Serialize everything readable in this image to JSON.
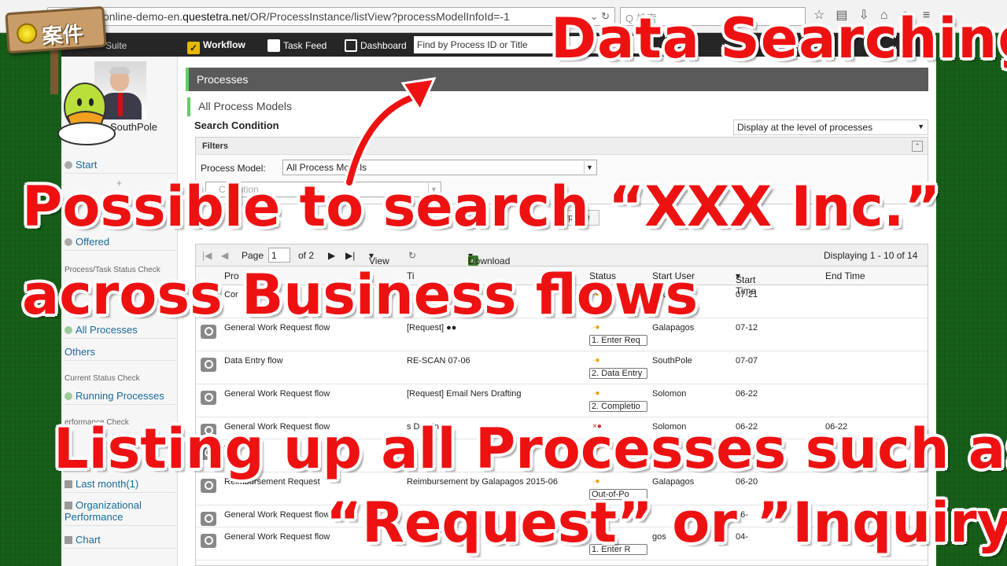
{
  "browser": {
    "url_prefix": "online-demo-en.",
    "url_domain": "questetra.net",
    "url_path": "/OR/ProcessInstance/listView?processModelInfoId=-1",
    "search_placeholder": "Q 検索"
  },
  "appnav": {
    "suite": "Suite",
    "workflow": "Workflow",
    "task_feed": "Task Feed",
    "dashboard": "Dashboard",
    "find_placeholder": "Find by Process ID or Title"
  },
  "sidebar": {
    "user": "SouthPole",
    "start": "Start",
    "offered": "Offered",
    "sec_status": "Process/Task Status Check",
    "started": "ted",
    "all_processes": "All Processes",
    "others": "Others",
    "sec_current": "Current Status Check",
    "running": "Running Processes",
    "sec_perf": "erformance Check",
    "last_month": "Last month(1)",
    "org_perf": "Organizational Performance",
    "chart": "Chart"
  },
  "main": {
    "processes_title": "Processes",
    "all_models": "All Process Models",
    "search_condition": "Search Condition",
    "display_level": "Display at the level of processes",
    "filters": "Filters",
    "process_model_label": "Process Model:",
    "process_model_value": "All Process Models",
    "condition_placeholder": "Condition",
    "update": "Update"
  },
  "grid": {
    "page_label": "Page",
    "page_value": "1",
    "of_pages": "of 2",
    "view": "View",
    "download": "Download",
    "displaying": "Displaying 1 - 10 of 14",
    "headers": [
      "Pro",
      "Ti",
      "Status",
      "Start User",
      "Start Time",
      "End Time"
    ],
    "rows": [
      {
        "model": "Cor",
        "title": "",
        "status": "",
        "user": "SouthPole",
        "start": "07-21",
        "end": "",
        "dot": "orange"
      },
      {
        "model": "General Work Request flow",
        "title": "[Request] ●●",
        "status": "1. Enter Req",
        "user": "Galapagos",
        "start": "07-12",
        "end": "",
        "dot": "orange"
      },
      {
        "model": "Data Entry flow",
        "title": "RE-SCAN 07-06",
        "status": "2. Data Entry",
        "user": "SouthPole",
        "start": "07-07",
        "end": "",
        "dot": "orange"
      },
      {
        "model": "General Work Request flow",
        "title": "[Request] Email Ners Drafting",
        "status": "2. Completio",
        "user": "Solomon",
        "start": "06-22",
        "end": "",
        "dot": "orange"
      },
      {
        "model": "General Work Request flow",
        "title": "s Drafting",
        "status": "",
        "user": "Solomon",
        "start": "06-22",
        "end": "06-22",
        "dot": "red"
      },
      {
        "model": "Wor",
        "title": "",
        "status": "",
        "user": "",
        "start": "0",
        "end": "",
        "dot": "orange"
      },
      {
        "model": "Reimbursement Request",
        "title": "Reimbursement by Galapagos 2015-06",
        "status": "Out-of-Po",
        "user": "Galapagos",
        "start": "06-20",
        "end": "",
        "dot": "orange"
      },
      {
        "model": "General Work Request flow",
        "title": "",
        "status": "",
        "user": "",
        "start": "06-",
        "end": "",
        "dot": "orange"
      },
      {
        "model": "General Work Request flow",
        "title": "",
        "status": "1. Enter R",
        "user": "gos",
        "start": "04-",
        "end": "",
        "dot": "orange"
      }
    ]
  },
  "overlays": {
    "badge": "案件",
    "line1": "Data Searching",
    "line2": "Possible to search “XXX Inc.”",
    "line3": "across Business flows",
    "line4": "Listing up all Processes such as",
    "line5": "“Request” or ”Inquiry”"
  },
  "colors": {
    "accent_red": "#ee1111",
    "nav_dark": "#262626",
    "header_bar": "#5a5a5a",
    "tab_green": "#66cc66"
  }
}
